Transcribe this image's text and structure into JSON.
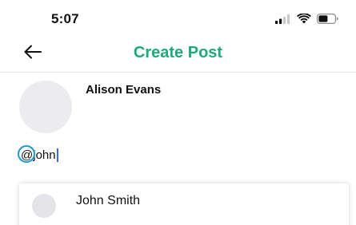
{
  "status_bar": {
    "time": "5:07",
    "icons": [
      "signal-icon",
      "wifi-icon",
      "battery-icon"
    ]
  },
  "header": {
    "back_icon": "back-arrow-icon",
    "title": "Create Post"
  },
  "author": {
    "name": "Alison Evans"
  },
  "post": {
    "at_symbol": "@",
    "mention_query": "john"
  },
  "suggestions": [
    {
      "name": "John Smith"
    }
  ],
  "colors": {
    "accent": "#1eaa7a",
    "caret": "#3a6fd8",
    "touch_indicator": "#1a9ad6",
    "avatar_placeholder": "#ececee"
  }
}
